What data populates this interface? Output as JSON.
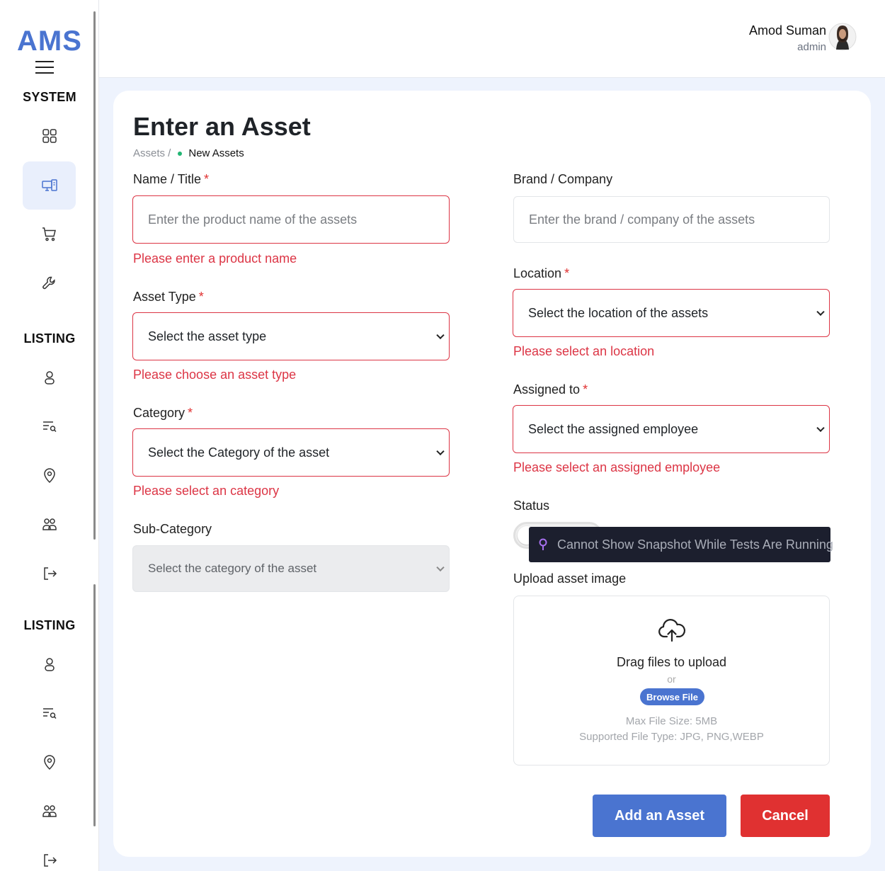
{
  "app": {
    "logo": "AMS"
  },
  "sidebar": {
    "sections": [
      {
        "title": "SYSTEM"
      },
      {
        "title": "LISTING"
      },
      {
        "title": "LISTING"
      }
    ],
    "items": [
      {
        "icon": "dashboard-icon"
      },
      {
        "icon": "devices-icon",
        "active": true
      },
      {
        "icon": "cart-icon"
      },
      {
        "icon": "wrench-icon"
      },
      {
        "icon": "user-icon"
      },
      {
        "icon": "list-search-icon"
      },
      {
        "icon": "location-pin-icon"
      },
      {
        "icon": "users-icon"
      },
      {
        "icon": "logout-icon"
      },
      {
        "icon": "user-icon"
      },
      {
        "icon": "list-search-icon"
      },
      {
        "icon": "location-pin-icon"
      },
      {
        "icon": "users-icon"
      },
      {
        "icon": "logout-icon"
      }
    ]
  },
  "header": {
    "user_name": "Amod Suman",
    "user_role": "admin"
  },
  "page": {
    "title": "Enter an Asset",
    "breadcrumb_parent": "Assets /",
    "breadcrumb_current": "New Assets"
  },
  "form": {
    "required_mark": "*",
    "name": {
      "label": "Name / Title",
      "placeholder": "Enter the product name of the assets",
      "error": "Please enter a product name"
    },
    "asset_type": {
      "label": "Asset Type",
      "value": "Select the asset type",
      "error": "Please choose an asset type"
    },
    "category": {
      "label": "Category",
      "value": "Select the Category of the asset",
      "error": "Please select an category"
    },
    "sub_category": {
      "label": "Sub-Category",
      "value": "Select the category of the asset"
    },
    "brand": {
      "label": "Brand / Company",
      "placeholder": "Enter the brand / company of the assets"
    },
    "location": {
      "label": "Location",
      "value": "Select the location of the assets",
      "error": "Please select an location"
    },
    "assigned_to": {
      "label": "Assigned to",
      "value": "Select the assigned employee",
      "error": "Please select an assigned employee"
    },
    "status": {
      "label": "Status",
      "tooltip": "Cannot Show Snapshot While Tests Are Running"
    },
    "upload": {
      "label": "Upload asset image",
      "drag_text": "Drag files to upload",
      "or_text": "or",
      "browse_label": "Browse File",
      "max_size": "Max File Size: 5MB",
      "file_types": "Supported File Type: JPG, PNG,WEBP"
    },
    "submit_label": "Add an Asset",
    "cancel_label": "Cancel"
  },
  "colors": {
    "brand": "#4a74d0",
    "error": "#dc3545",
    "cancel": "#e03131",
    "success_dot": "#22b573"
  }
}
